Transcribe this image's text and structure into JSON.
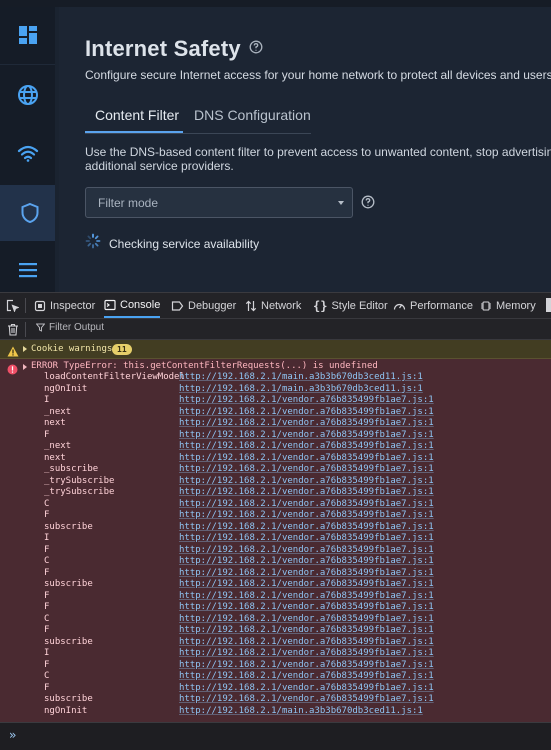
{
  "app": {
    "title": "Internet Safety",
    "subtitle": "Configure secure Internet access for your home network to protect all devices and users fro",
    "tabs": [
      {
        "label": "Content Filter",
        "active": true
      },
      {
        "label": "DNS Configuration",
        "active": false
      }
    ],
    "description_line1": "Use the DNS-based content filter to prevent access to unwanted content, stop advertising, b",
    "description_line2": "additional service providers.",
    "filter_mode_placeholder": "Filter mode",
    "checking_text": "Checking service availability",
    "sidebar": [
      "dashboard-icon",
      "globe-icon",
      "wifi-icon",
      "shield-icon",
      "menu-icon"
    ],
    "colors": {
      "accent": "#5aa3ee",
      "background": "#1c2533",
      "sidebar": "#151c27",
      "sidebar_active": "#22324a"
    }
  },
  "devtools": {
    "tabs": [
      {
        "label": "Inspector"
      },
      {
        "label": "Console",
        "active": true
      },
      {
        "label": "Debugger"
      },
      {
        "label": "Network"
      },
      {
        "label": "Style Editor"
      },
      {
        "label": "Performance"
      },
      {
        "label": "Memory"
      }
    ],
    "filter_placeholder": "Filter Output",
    "warning": {
      "label": "Cookie warnings",
      "count": "11"
    },
    "error": {
      "message": "ERROR TypeError: this.getContentFilterRequests(...) is undefined",
      "frames": [
        {
          "fn": "loadContentFilterViewModel",
          "loc": "http://192.168.2.1/main.a3b3b670db3ced11.js:1"
        },
        {
          "fn": "ngOnInit",
          "loc": "http://192.168.2.1/main.a3b3b670db3ced11.js:1"
        },
        {
          "fn": "I",
          "loc": "http://192.168.2.1/vendor.a76b835499fb1ae7.js:1"
        },
        {
          "fn": "_next",
          "loc": "http://192.168.2.1/vendor.a76b835499fb1ae7.js:1"
        },
        {
          "fn": "next",
          "loc": "http://192.168.2.1/vendor.a76b835499fb1ae7.js:1"
        },
        {
          "fn": "F",
          "loc": "http://192.168.2.1/vendor.a76b835499fb1ae7.js:1"
        },
        {
          "fn": "_next",
          "loc": "http://192.168.2.1/vendor.a76b835499fb1ae7.js:1"
        },
        {
          "fn": "next",
          "loc": "http://192.168.2.1/vendor.a76b835499fb1ae7.js:1"
        },
        {
          "fn": "_subscribe",
          "loc": "http://192.168.2.1/vendor.a76b835499fb1ae7.js:1"
        },
        {
          "fn": "_trySubscribe",
          "loc": "http://192.168.2.1/vendor.a76b835499fb1ae7.js:1"
        },
        {
          "fn": "_trySubscribe",
          "loc": "http://192.168.2.1/vendor.a76b835499fb1ae7.js:1"
        },
        {
          "fn": "C",
          "loc": "http://192.168.2.1/vendor.a76b835499fb1ae7.js:1"
        },
        {
          "fn": "F",
          "loc": "http://192.168.2.1/vendor.a76b835499fb1ae7.js:1"
        },
        {
          "fn": "subscribe",
          "loc": "http://192.168.2.1/vendor.a76b835499fb1ae7.js:1"
        },
        {
          "fn": "I",
          "loc": "http://192.168.2.1/vendor.a76b835499fb1ae7.js:1"
        },
        {
          "fn": "F",
          "loc": "http://192.168.2.1/vendor.a76b835499fb1ae7.js:1"
        },
        {
          "fn": "C",
          "loc": "http://192.168.2.1/vendor.a76b835499fb1ae7.js:1"
        },
        {
          "fn": "F",
          "loc": "http://192.168.2.1/vendor.a76b835499fb1ae7.js:1"
        },
        {
          "fn": "subscribe",
          "loc": "http://192.168.2.1/vendor.a76b835499fb1ae7.js:1"
        },
        {
          "fn": "F",
          "loc": "http://192.168.2.1/vendor.a76b835499fb1ae7.js:1"
        },
        {
          "fn": "F",
          "loc": "http://192.168.2.1/vendor.a76b835499fb1ae7.js:1"
        },
        {
          "fn": "C",
          "loc": "http://192.168.2.1/vendor.a76b835499fb1ae7.js:1"
        },
        {
          "fn": "F",
          "loc": "http://192.168.2.1/vendor.a76b835499fb1ae7.js:1"
        },
        {
          "fn": "subscribe",
          "loc": "http://192.168.2.1/vendor.a76b835499fb1ae7.js:1"
        },
        {
          "fn": "I",
          "loc": "http://192.168.2.1/vendor.a76b835499fb1ae7.js:1"
        },
        {
          "fn": "F",
          "loc": "http://192.168.2.1/vendor.a76b835499fb1ae7.js:1"
        },
        {
          "fn": "C",
          "loc": "http://192.168.2.1/vendor.a76b835499fb1ae7.js:1"
        },
        {
          "fn": "F",
          "loc": "http://192.168.2.1/vendor.a76b835499fb1ae7.js:1"
        },
        {
          "fn": "subscribe",
          "loc": "http://192.168.2.1/vendor.a76b835499fb1ae7.js:1"
        },
        {
          "fn": "ngOnInit",
          "loc": "http://192.168.2.1/main.a3b3b670db3ced11.js:1"
        }
      ]
    },
    "prompt": "»",
    "colors": {
      "active_tab": "#4aa3f2",
      "error_bg": "#4a2a31",
      "warning_bg": "#423d22"
    }
  }
}
